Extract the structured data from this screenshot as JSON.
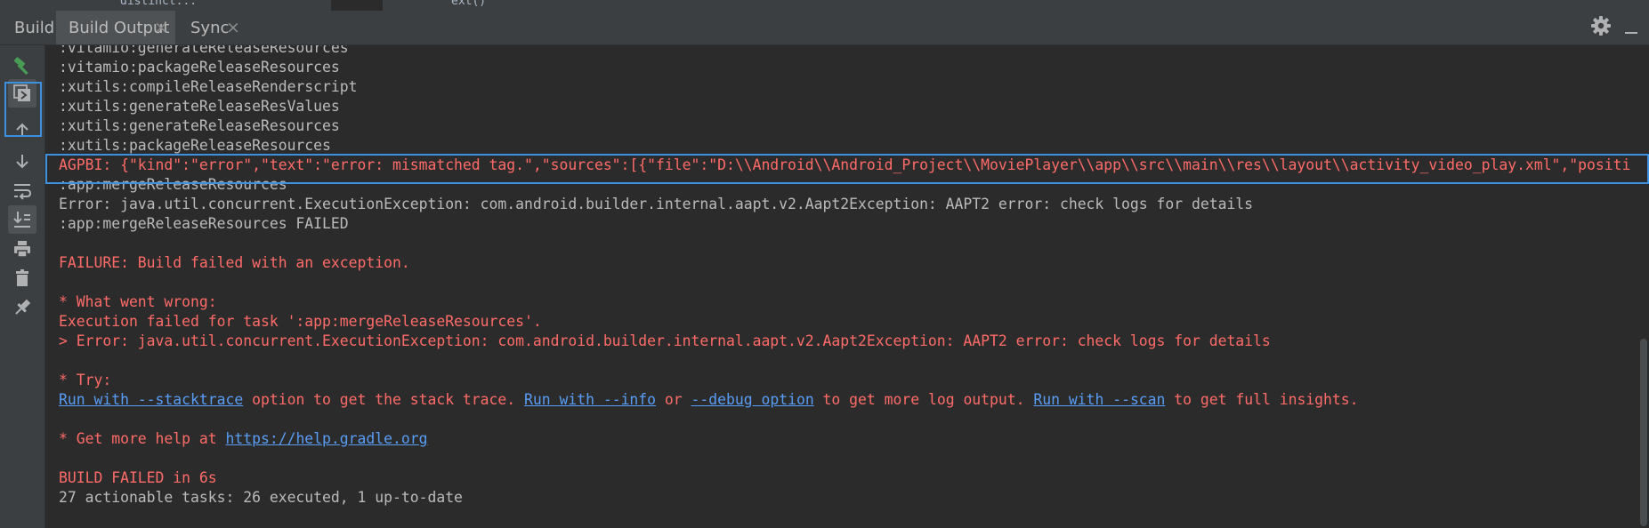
{
  "top_strip": {
    "fragment_left": "distinct...",
    "fragment_right": "ext()"
  },
  "tabbar": {
    "label": "Build:",
    "tabs": [
      {
        "label": "Build Output",
        "close": "×",
        "active": true
      },
      {
        "label": "Sync",
        "close": "×",
        "active": false
      }
    ]
  },
  "sidebar": {
    "buttons": [
      "hammer-icon",
      "console-view-icon",
      "arrow-up-icon",
      "arrow-down-icon",
      "soft-wrap-icon",
      "scroll-to-end-icon",
      "print-icon",
      "trash-icon",
      "pin-icon"
    ],
    "toggled": [
      "console-view-icon",
      "scroll-to-end-icon"
    ]
  },
  "console": {
    "lines": [
      {
        "text": ":vitamio:generateReleaseResources"
      },
      {
        "text": ":vitamio:packageReleaseResources"
      },
      {
        "text": ":xutils:compileReleaseRenderscript"
      },
      {
        "text": ":xutils:generateReleaseResValues"
      },
      {
        "text": ":xutils:generateReleaseResources"
      },
      {
        "text": ":xutils:packageReleaseResources"
      },
      {
        "text": "AGPBI: {\"kind\":\"error\",\"text\":\"error: mismatched tag.\",\"sources\":[{\"file\":\"D:\\\\Android\\\\Android_Project\\\\MoviePlayer\\\\app\\\\src\\\\main\\\\res\\\\layout\\\\activity_video_play.xml\",\"positi",
        "error": true,
        "highlight": true
      },
      {
        "text": ":app:mergeReleaseResources"
      },
      {
        "text": "Error: java.util.concurrent.ExecutionException: com.android.builder.internal.aapt.v2.Aapt2Exception: AAPT2 error: check logs for details"
      },
      {
        "text": ":app:mergeReleaseResources FAILED"
      },
      {
        "text": ""
      },
      {
        "text": "FAILURE: Build failed with an exception.",
        "error": true
      },
      {
        "text": ""
      },
      {
        "text": "* What went wrong:",
        "error": true
      },
      {
        "text": "Execution failed for task ':app:mergeReleaseResources'.",
        "error": true
      },
      {
        "text": "> Error: java.util.concurrent.ExecutionException: com.android.builder.internal.aapt.v2.Aapt2Exception: AAPT2 error: check logs for details",
        "error": true
      },
      {
        "text": ""
      },
      {
        "text": "* Try:",
        "error": true
      },
      {
        "segments": [
          {
            "text": "Run with --stacktrace",
            "link": true
          },
          {
            "text": " option to get the stack trace. "
          },
          {
            "text": "Run with --info",
            "link": true
          },
          {
            "text": " or "
          },
          {
            "text": "--debug option",
            "link": true
          },
          {
            "text": " to get more log output. "
          },
          {
            "text": "Run with --scan",
            "link": true
          },
          {
            "text": " to get full insights."
          }
        ],
        "error": true
      },
      {
        "text": ""
      },
      {
        "segments": [
          {
            "text": "* Get more help at "
          },
          {
            "text": "https://help.gradle.org",
            "link": true
          }
        ],
        "error": true
      },
      {
        "text": ""
      },
      {
        "text": "BUILD FAILED in 6s",
        "error": true
      },
      {
        "text": "27 actionable tasks: 26 executed, 1 up-to-date"
      }
    ]
  },
  "colors": {
    "error": "#ff6b68",
    "link": "#589df6",
    "text": "#bbbbbb",
    "highlight": "#3d8fe0",
    "background": "#2b2b2b",
    "panel": "#3c3f41"
  }
}
